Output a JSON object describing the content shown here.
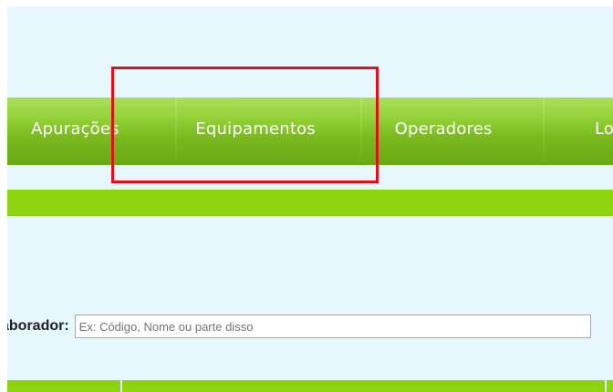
{
  "nav": {
    "items": [
      {
        "label": "Apurações"
      },
      {
        "label": "Equipamentos"
      },
      {
        "label": "Operadores"
      },
      {
        "label": "Lo"
      }
    ]
  },
  "search": {
    "label": "aborador:",
    "placeholder": "Ex: Código, Nome ou parte disso",
    "value": ""
  },
  "colors": {
    "page_background": "#e6f7fd",
    "nav_green": "#79b91e",
    "accent_green": "#8ed30f",
    "highlight_red": "#e0101a"
  }
}
